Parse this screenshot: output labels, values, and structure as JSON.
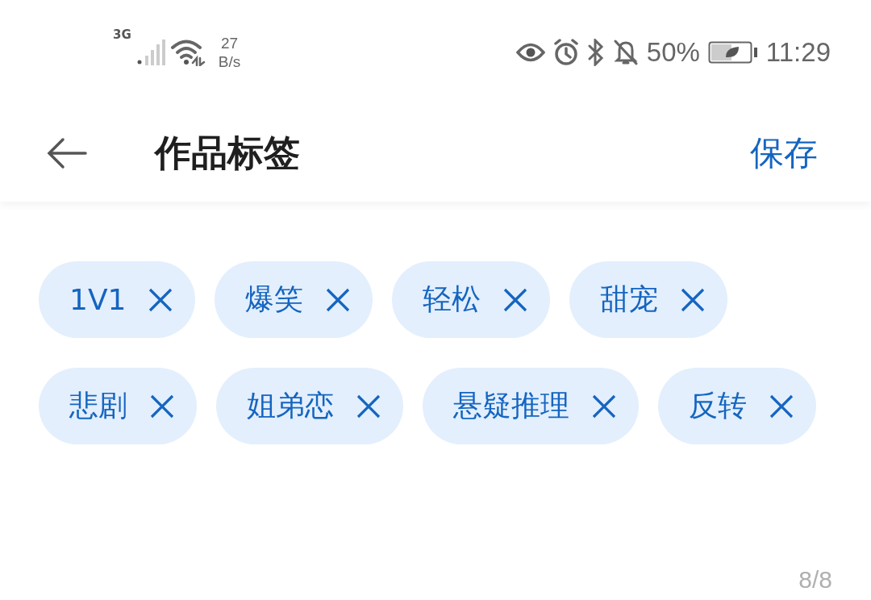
{
  "status_bar": {
    "network": "3G",
    "speed_value": "27",
    "speed_unit": "B/s",
    "battery": "50%",
    "time": "11:29"
  },
  "header": {
    "title": "作品标签",
    "action": "保存"
  },
  "tags": [
    {
      "label": "1V1"
    },
    {
      "label": "爆笑"
    },
    {
      "label": "轻松"
    },
    {
      "label": "甜宠"
    },
    {
      "label": "悲剧"
    },
    {
      "label": "姐弟恋"
    },
    {
      "label": "悬疑推理"
    },
    {
      "label": "反转"
    }
  ],
  "counter": "8/8"
}
